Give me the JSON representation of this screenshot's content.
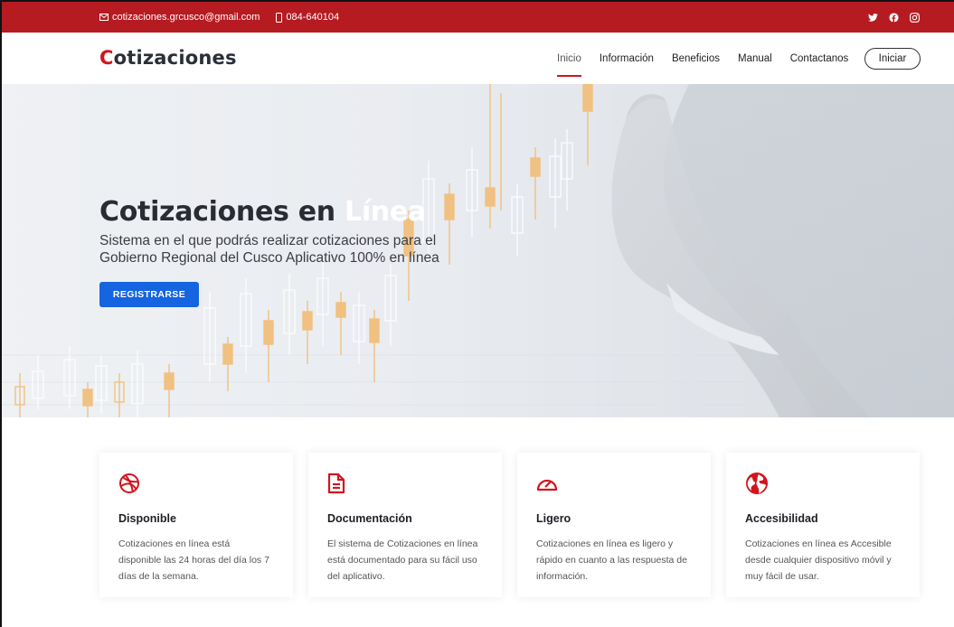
{
  "topbar": {
    "email": "cotizaciones.grcusco@gmail.com",
    "phone": "084-640104",
    "social": [
      "twitter-icon",
      "facebook-icon",
      "instagram-icon"
    ]
  },
  "header": {
    "logo_first": "C",
    "logo_rest": "otizaciones",
    "nav": [
      "Inicio",
      "Información",
      "Beneficios",
      "Manual",
      "Contactanos"
    ],
    "active_nav": "Inicio",
    "login_label": "Iniciar"
  },
  "hero": {
    "title_main": "Cotizaciones en ",
    "title_accent": "Línea",
    "subtitle": "Sistema en el que podrás realizar cotizaciones para el Gobierno Regional del Cusco Aplicativo 100% en línea",
    "cta_label": "REGISTRARSE"
  },
  "features": [
    {
      "icon": "dribbble-icon",
      "title": "Disponible",
      "text": "Cotizaciones en línea está disponible las 24 horas del día los 7 días de la semana."
    },
    {
      "icon": "document-icon",
      "title": "Documentación",
      "text": "El sistema de Cotizaciones en línea está documentado para su fácil uso del aplicativo."
    },
    {
      "icon": "speedometer-icon",
      "title": "Ligero",
      "text": "Cotizaciones en línea es ligero y rápido en cuanto a las respuesta de información."
    },
    {
      "icon": "globe-icon",
      "title": "Accesibilidad",
      "text": "Cotizaciones en línea es Accesible desde cualquier dispositivo móvil y muy fácil de usar."
    }
  ],
  "colors": {
    "brand_red": "#b61b21",
    "accent_red": "#d3141d",
    "button_blue": "#1564e0"
  }
}
